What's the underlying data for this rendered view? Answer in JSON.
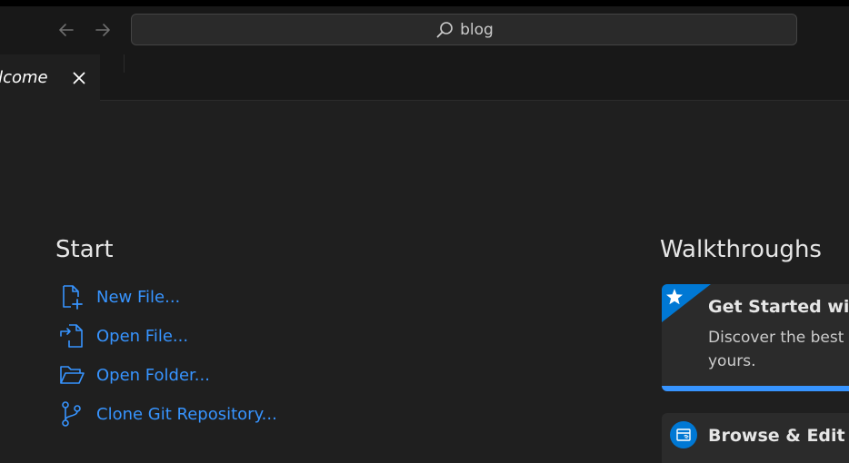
{
  "titlebar": {
    "search_text": "blog",
    "back_icon": "arrow-left-icon",
    "forward_icon": "arrow-right-icon",
    "search_icon": "search-icon"
  },
  "tabs": [
    {
      "label": "Welcome",
      "visible_label": "elcome",
      "icon": "close-icon"
    }
  ],
  "start": {
    "title": "Start",
    "items": [
      {
        "label": "New File...",
        "icon": "new-file-icon"
      },
      {
        "label": "Open File...",
        "icon": "open-file-icon"
      },
      {
        "label": "Open Folder...",
        "icon": "open-folder-icon"
      },
      {
        "label": "Clone Git Repository...",
        "icon": "git-branch-icon"
      }
    ]
  },
  "walkthroughs": {
    "title": "Walkthroughs",
    "cards": [
      {
        "title": "Get Started with",
        "description": "Discover the best c yours.",
        "badge_icon": "star-icon",
        "progress": 1.0
      },
      {
        "title": "Browse & Edit Re",
        "icon": "remote-repo-icon"
      }
    ]
  },
  "colors": {
    "background": "#1f1f1f",
    "titlebar": "#181818",
    "link": "#3794ff",
    "accent": "#0078d4",
    "text": "#cccccc"
  }
}
